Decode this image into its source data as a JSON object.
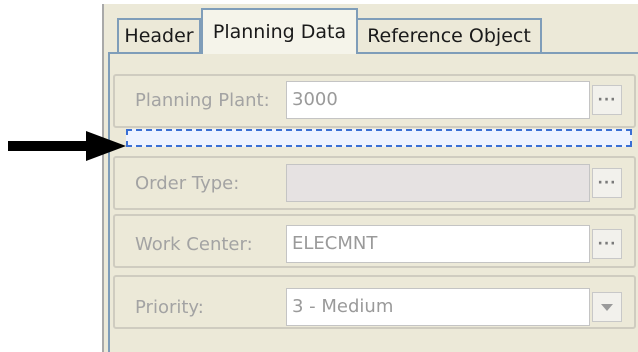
{
  "tabs": [
    {
      "label": "Header",
      "active": false
    },
    {
      "label": "Planning Data",
      "active": true
    },
    {
      "label": "Reference Object",
      "active": false
    }
  ],
  "fields": {
    "planning_plant": {
      "label": "Planning Plant:",
      "value": "3000"
    },
    "order_type": {
      "label": "Order Type:",
      "value": ""
    },
    "work_center": {
      "label": "Work Center:",
      "value": "ELECMNT"
    },
    "priority": {
      "label": "Priority:",
      "value": "3 - Medium"
    }
  },
  "icons": {
    "value_help": "ellipsis-icon",
    "dropdown": "chevron-down-icon",
    "pointer": "arrow-right-icon"
  },
  "colors": {
    "drop_indicator": "#3a6fd4",
    "pointer_arrow": "#000000",
    "tab_border": "#7f9db9",
    "panel_bg": "#ece9d8"
  }
}
